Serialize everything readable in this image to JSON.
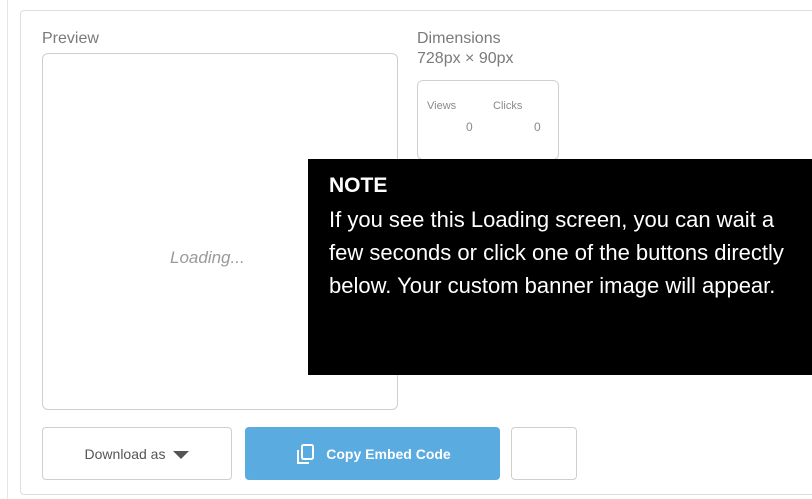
{
  "preview": {
    "label": "Preview",
    "loading_text": "Loading..."
  },
  "dimensions": {
    "label": "Dimensions",
    "value": "728px × 90px"
  },
  "stats": {
    "views_label": "Views",
    "views_value": "0",
    "clicks_label": "Clicks",
    "clicks_value": "0"
  },
  "note": {
    "title": "NOTE",
    "body": "If you see this Loading screen, you can wait a few seconds or click one of the buttons directly below. Your custom banner image will appear."
  },
  "buttons": {
    "download_label": "Download as",
    "copy_label": "Copy Embed Code"
  },
  "icons": {
    "download_caret": "chevron-down-icon",
    "copy": "copy-icon"
  },
  "colors": {
    "copy_button_bg": "#5aabdf",
    "note_bg": "#000000"
  }
}
